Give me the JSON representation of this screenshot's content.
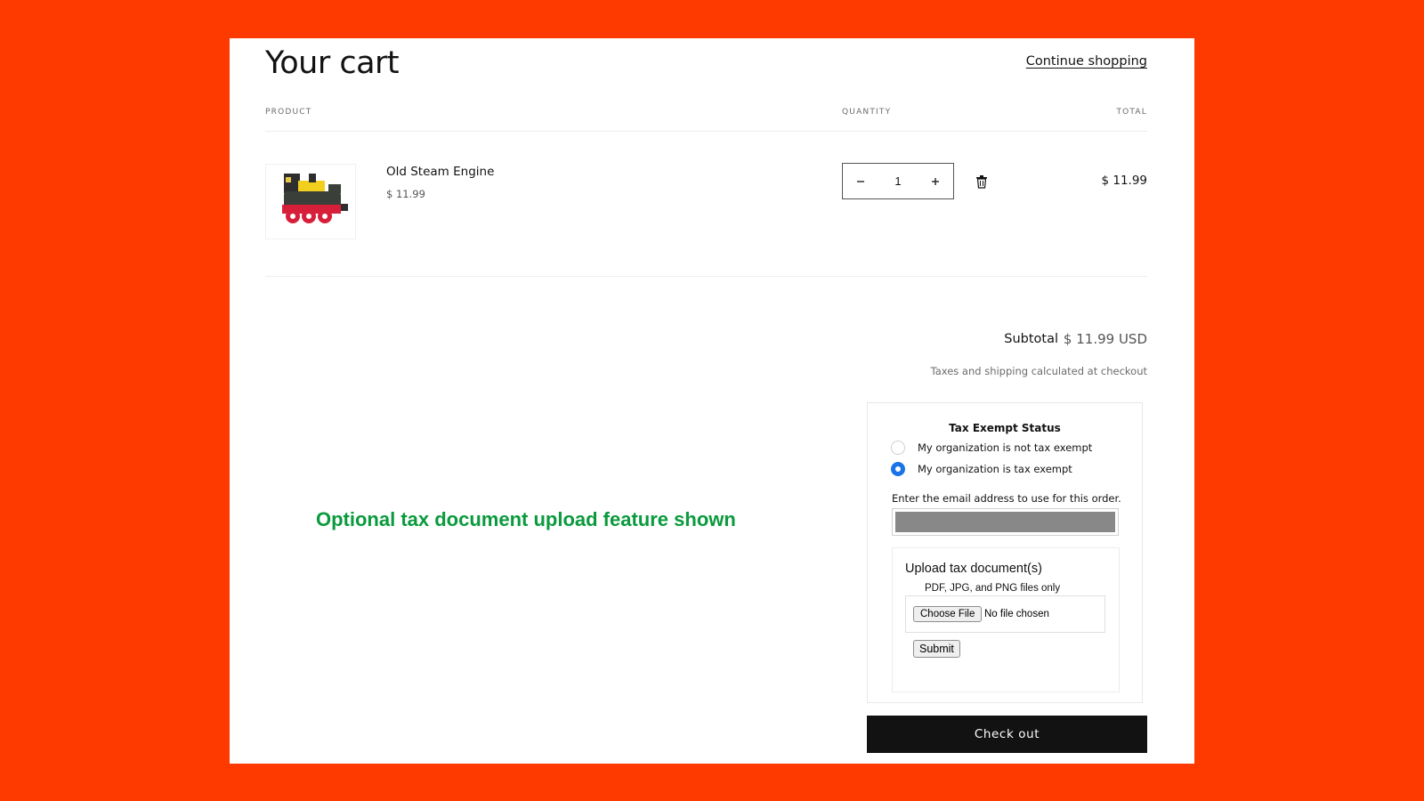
{
  "colors": {
    "background": "#ff3a00",
    "accent_radio": "#1a73e8",
    "checkout_bg": "#121212",
    "overlay_text": "#0a9a3d"
  },
  "header": {
    "title": "Your cart",
    "continue_label": "Continue shopping"
  },
  "table": {
    "columns": {
      "product": "PRODUCT",
      "quantity": "QUANTITY",
      "total": "TOTAL"
    },
    "items": [
      {
        "name": "Old Steam Engine",
        "price": "$ 11.99",
        "quantity": "1",
        "total": "$ 11.99",
        "image_icon": "toy-train-icon"
      }
    ]
  },
  "summary": {
    "subtotal_label": "Subtotal",
    "subtotal_value": "$ 11.99 USD",
    "tax_note": "Taxes and shipping calculated at checkout"
  },
  "tax_exempt": {
    "title": "Tax Exempt Status",
    "options": [
      {
        "label": "My organization is not tax exempt",
        "selected": false
      },
      {
        "label": "My organization is tax exempt",
        "selected": true
      }
    ],
    "email_hint": "Enter the email address to use for this order.",
    "upload": {
      "title": "Upload tax document(s)",
      "note": "PDF, JPG, and PNG files only",
      "choose_label": "Choose File",
      "no_file": "No file chosen",
      "submit_label": "Submit"
    }
  },
  "checkout_label": "Check out",
  "overlay_caption": "Optional tax document upload feature shown"
}
